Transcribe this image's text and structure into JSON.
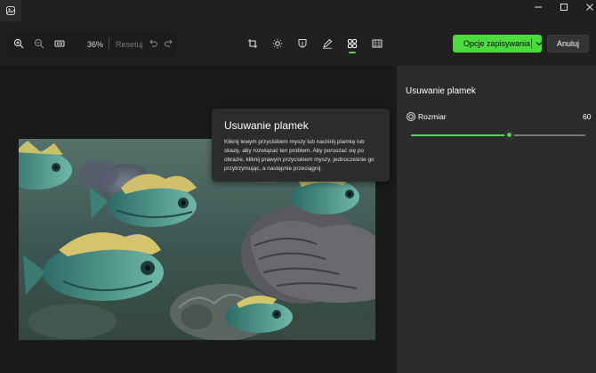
{
  "window": {
    "app_icon": "photos-app-icon",
    "controls": [
      "minimize-icon",
      "maximize-icon",
      "close-icon"
    ]
  },
  "toolbar": {
    "zoom_in_icon": "zoom-in-icon",
    "zoom_out_icon": "zoom-out-icon",
    "fit_icon": "fit-to-window-icon",
    "zoom_level": "36%",
    "reset_label": "Resetuj",
    "undo_icon": "undo-icon",
    "redo_icon": "redo-icon",
    "tools": [
      {
        "name": "crop",
        "icon": "crop-icon",
        "active": false
      },
      {
        "name": "adjust",
        "icon": "brightness-icon",
        "active": false
      },
      {
        "name": "filter",
        "icon": "filter-icon",
        "active": false
      },
      {
        "name": "markup",
        "icon": "pen-icon",
        "active": false
      },
      {
        "name": "retouch",
        "icon": "spot-fix-icon",
        "active": true
      },
      {
        "name": "background",
        "icon": "background-icon",
        "active": false
      }
    ],
    "save_label": "Opcje zapisywania",
    "cancel_label": "Anuluj"
  },
  "tooltip": {
    "title": "Usuwanie plamek",
    "body": "Kliknij lewym przyciskiem myszy lub naciśnij plamkę lub skazę, aby rozwiązać ten problem. Aby poruszać się po obrazie, kliknij prawym przyciskiem myszy, jednocześnie go przytrzymując, a następnie przeciągnij."
  },
  "panel": {
    "title": "Usuwanie plamek",
    "size_label": "Rozmiar",
    "size_value": "60",
    "slider_fraction": 0.56
  },
  "colors": {
    "accent": "#4cdb3c",
    "background": "#202020",
    "panel": "#2b2b2b"
  }
}
